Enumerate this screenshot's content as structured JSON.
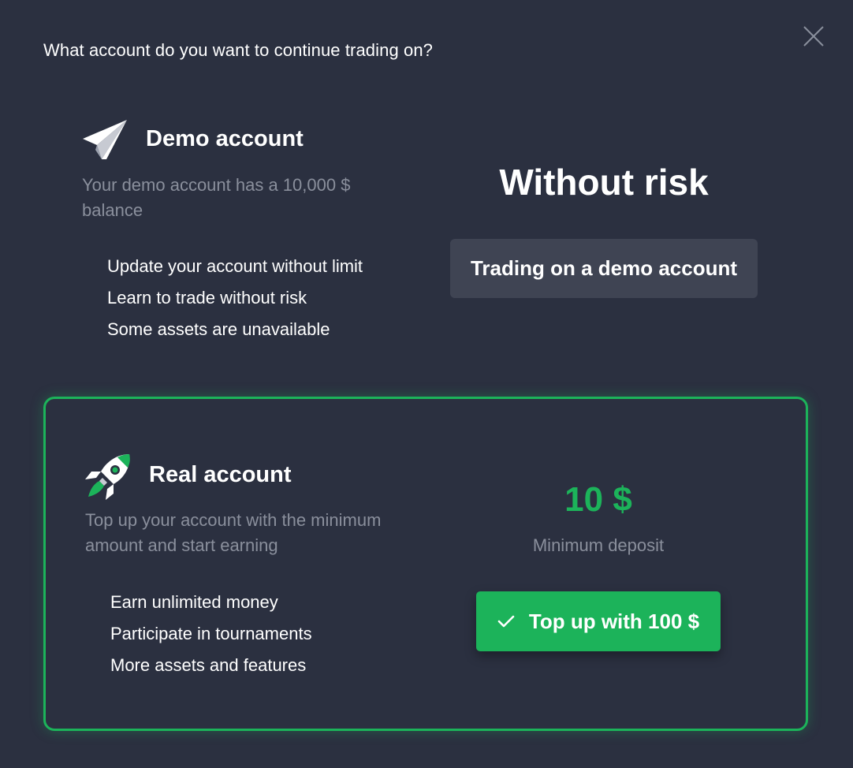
{
  "modal": {
    "title": "What account do you want to continue trading on?"
  },
  "demo": {
    "icon": "paper-plane-icon",
    "title": "Demo account",
    "description": "Your demo account has a 10,000 $ balance",
    "features": [
      "Update your account without limit",
      "Learn to trade without risk",
      "Some assets are unavailable"
    ],
    "headline": "Without risk",
    "button_label": "Trading on a demo account"
  },
  "real": {
    "icon": "rocket-icon",
    "title": "Real account",
    "description": "Top up your account with the minimum amount and start earning",
    "features": [
      "Earn unlimited money",
      "Participate in tournaments",
      "More assets and features"
    ],
    "deposit_amount": "10 $",
    "deposit_label": "Minimum deposit",
    "button_label": "Top up with 100 $"
  },
  "colors": {
    "background": "#2b3040",
    "accent": "#1cb35a",
    "muted_text": "#8a8f9c",
    "secondary_button": "#3f4453"
  }
}
